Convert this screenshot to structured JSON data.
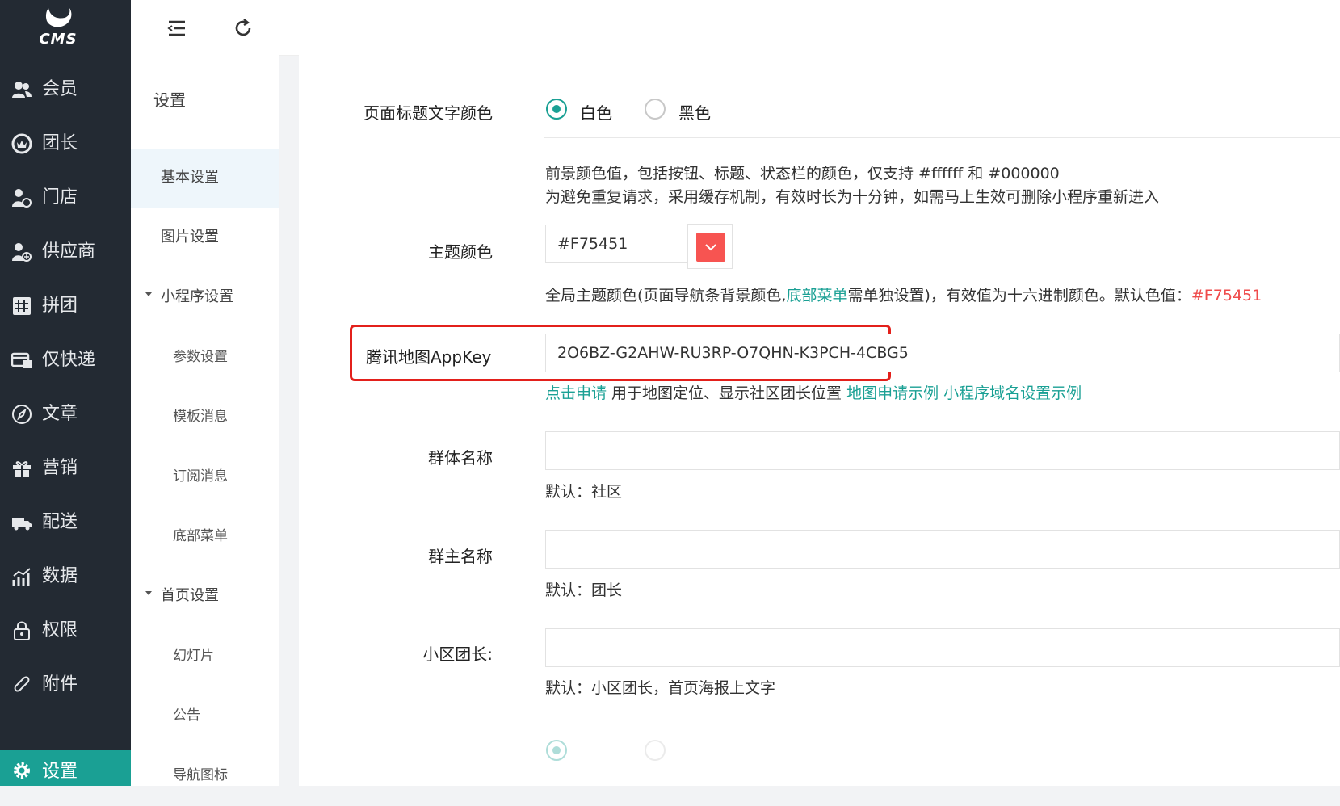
{
  "colors": {
    "sidebar_bg": "#232a33",
    "accent": "#1aa094",
    "theme_swatch": "#F75451",
    "highlight": "#e3201b"
  },
  "logo": {
    "text": "CMS",
    "icon": "bird-logo-icon"
  },
  "sidebar": {
    "items": [
      {
        "label": "会员",
        "icon": "users-icon"
      },
      {
        "label": "团长",
        "icon": "crown-icon"
      },
      {
        "label": "门店",
        "icon": "store-user-icon"
      },
      {
        "label": "供应商",
        "icon": "supplier-icon"
      },
      {
        "label": "拼团",
        "icon": "group-buy-icon"
      },
      {
        "label": "仅快递",
        "icon": "express-icon"
      },
      {
        "label": "文章",
        "icon": "compass-icon"
      },
      {
        "label": "营销",
        "icon": "gift-icon"
      },
      {
        "label": "配送",
        "icon": "truck-icon"
      },
      {
        "label": "数据",
        "icon": "chart-icon"
      },
      {
        "label": "权限",
        "icon": "lock-icon"
      },
      {
        "label": "附件",
        "icon": "paperclip-icon"
      },
      {
        "label": "设置",
        "icon": "gear-icon"
      }
    ]
  },
  "topbar": {
    "menu_toggle_icon": "menu-collapse-icon",
    "refresh_icon": "refresh-icon"
  },
  "submenu": {
    "heading": "设置",
    "items": [
      {
        "label": "基本设置"
      },
      {
        "label": "图片设置"
      },
      {
        "label": "小程序设置"
      },
      {
        "label": "参数设置"
      },
      {
        "label": "模板消息"
      },
      {
        "label": "订阅消息"
      },
      {
        "label": "底部菜单"
      },
      {
        "label": "首页设置"
      },
      {
        "label": "幻灯片"
      },
      {
        "label": "公告"
      },
      {
        "label": "导航图标"
      }
    ]
  },
  "form": {
    "title_color": {
      "label": "页面标题文字颜色",
      "options": [
        "白色",
        "黑色"
      ],
      "selected": "白色",
      "help_line1": "前景颜色值，包括按钮、标题、状态栏的颜色，仅支持 #ffffff 和 #000000",
      "help_line2": "为避免重复请求，采用缓存机制，有效时长为十分钟，如需马上生效可删除小程序重新进入"
    },
    "theme_color": {
      "label": "主题颜色",
      "value": "#F75451",
      "help_a": "全局主题颜色(页面导航条背景颜色,",
      "help_link": "底部菜单",
      "help_b": "需单独设置)，有效值为十六进制颜色。默认色值：",
      "help_default": "#F75451"
    },
    "map_key": {
      "label": "腾讯地图AppKey",
      "value": "2O6BZ-G2AHW-RU3RP-O7QHN-K3PCH-4CBG5",
      "link_apply": "点击申请",
      "help": " 用于地图定位、显示社区团长位置 ",
      "link_example": "地图申请示例",
      "link_domain": "小程序域名设置示例"
    },
    "group_name": {
      "label": "群体名称",
      "value": "",
      "help": "默认：社区"
    },
    "group_owner": {
      "label": "群主名称",
      "value": "",
      "help": "默认：团长"
    },
    "community_leader": {
      "label": "小区团长:",
      "value": "",
      "help": "默认：小区团长，首页海报上文字"
    }
  }
}
